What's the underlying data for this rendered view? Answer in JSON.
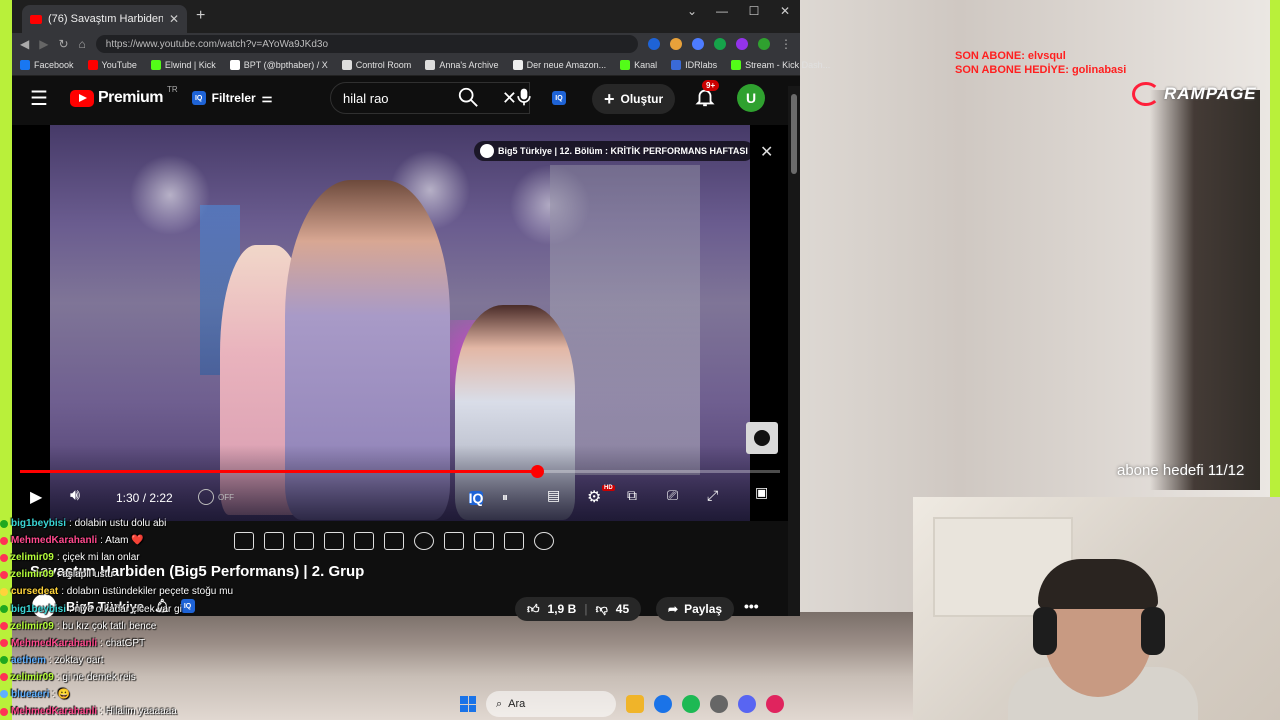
{
  "stream_overlay": {
    "son_abone": "SON ABONE: elvsqul",
    "son_abone_hediye": "SON ABONE HEDİYE: golinabasi",
    "rampage": "RAMPAGE",
    "abone_hedefi": "abone hedefi 11/12"
  },
  "browser": {
    "tab_title": "(76) Savaştım Harbiden (Big",
    "new_tab": "+",
    "url": "https://www.youtube.com/watch?v=AYoWa9JKd3o",
    "bookmarks": [
      {
        "label": "Facebook",
        "color": "#1877f2"
      },
      {
        "label": "YouTube",
        "color": "#ff0000"
      },
      {
        "label": "Elwind | Kick",
        "color": "#53fc18"
      },
      {
        "label": "BPT (@bpthaber) / X",
        "color": "#ffffff"
      },
      {
        "label": "Control Room",
        "color": "#dddddd"
      },
      {
        "label": "Anna's Archive",
        "color": "#dddddd"
      },
      {
        "label": "Der neue Amazon...",
        "color": "#eeeeee"
      },
      {
        "label": "Kanal",
        "color": "#53fc18"
      },
      {
        "label": "IDRlabs",
        "color": "#3a6ad8"
      },
      {
        "label": "Stream - Kick Dash...",
        "color": "#53fc18"
      }
    ]
  },
  "youtube": {
    "premium": "Premium",
    "region": "TR",
    "filters": "Filtreler",
    "search_query": "hilal rao",
    "create": "Oluştur",
    "notifications": "9+",
    "avatar_letter": "U",
    "banner_text": "Big5 Türkiye | 12. Bölüm : KRİTİK PERFORMANS HAFTASI",
    "time": "1:30 / 2:22",
    "progress": 0.68,
    "cc_off": "OFF",
    "hd": "HD",
    "video_title": "Savaştım Harbiden (Big5 Performans) | 2. Grup",
    "channel_name": "Big5 Türkiye",
    "likes": "1,9 B",
    "dislikes": "45",
    "share": "Paylaş",
    "more": "•••"
  },
  "chat": [
    {
      "user": "big1beybisi",
      "color": "#3ad6d6",
      "badge": "#1fa81f",
      "msg": ": dolabin ustu dolu abi"
    },
    {
      "user": "MehmedKarahanli",
      "color": "#ff4a8d",
      "badge": "#ff3355",
      "msg": ": Atam ❤️"
    },
    {
      "user": "zelimir09",
      "color": "#b6ff3b",
      "badge": "#ff3355",
      "msg": ": çiçek mi lan onlar"
    },
    {
      "user": "zelimir09",
      "color": "#b6ff3b",
      "badge": "#ff3355",
      "msg": ": aşlaplı ustu"
    },
    {
      "user": "cursedeat",
      "color": "#ffd43a",
      "badge": "#ffd43a",
      "msg": ": dolabın üstündekiler peçete stoğu mu"
    },
    {
      "user": "big1beybisi",
      "color": "#3ad6d6",
      "badge": "#1fa81f",
      "msg": ": niye o kadar çicek var gi"
    },
    {
      "user": "zelimir09",
      "color": "#b6ff3b",
      "badge": "#ff3355",
      "msg": ": bu kız çok tatlı bence"
    },
    {
      "user": "MehmedKarahanli",
      "color": "#ff4a8d",
      "badge": "#ff3355",
      "msg": ": chatGPT"
    },
    {
      "user": "aethem",
      "color": "#5fb0ff",
      "badge": "#1fa81f",
      "msg": ": zoktay oart"
    },
    {
      "user": "zelimir09",
      "color": "#b6ff3b",
      "badge": "#ff3355",
      "msg": ": gi ne demek reis"
    },
    {
      "user": "blueaeri",
      "color": "#5fb0ff",
      "badge": "#5fb0ff",
      "msg": ": 😀"
    },
    {
      "user": "MehmedKarahanli",
      "color": "#ff4a8d",
      "badge": "#ff3355",
      "msg": ": Hilalim yaaaaaa"
    }
  ],
  "taskbar": {
    "search_label": "Ara"
  }
}
